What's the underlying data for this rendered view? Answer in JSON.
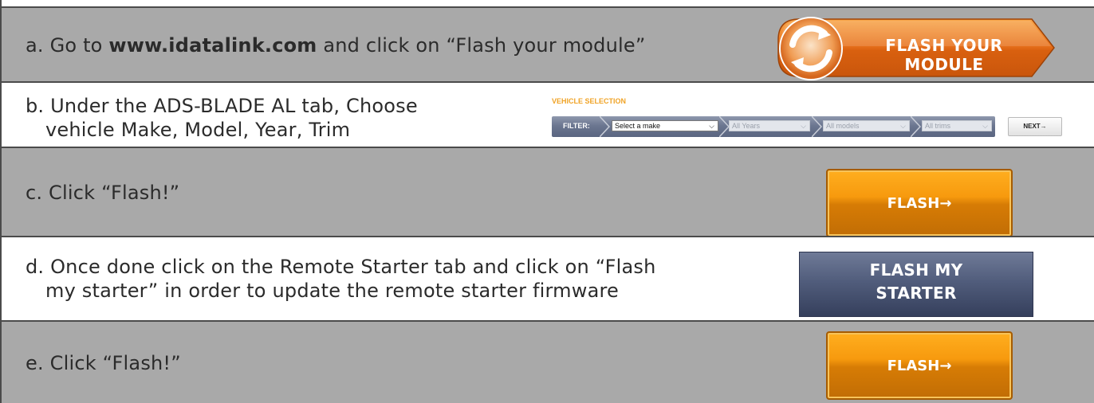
{
  "steps": {
    "a": {
      "prefix": "a. Go to ",
      "link": "www.idatalink.com",
      "suffix": " and click on “Flash your module”",
      "button_label": "FLASH YOUR MODULE",
      "icon": "refresh-icon"
    },
    "b": {
      "line1": "b. Under the ADS-BLADE AL tab, Choose",
      "line2": "vehicle Make, Model, Year, Trim",
      "widget": {
        "title": "VEHICLE SELECTION",
        "filter_label": "FILTER:",
        "make": "Select a make",
        "years": "All Years",
        "models": "All models",
        "trims": "All trims",
        "next": "NEXT→"
      }
    },
    "c": {
      "text": "c. Click “Flash!”",
      "button_label": "FLASH→"
    },
    "d": {
      "line1": "d. Once done click on the Remote Starter tab and click on “Flash",
      "line2": "my starter” in order to update the remote starter firmware",
      "button_line1": "FLASH MY",
      "button_line2": "STARTER"
    },
    "e": {
      "text": "e. Click “Flash!”",
      "button_label": "FLASH→"
    }
  },
  "colors": {
    "row_gray": "#a9a9a9",
    "border": "#4b4b4b",
    "orange": "#f79a0e",
    "navy": "#515d7c",
    "accent_title": "#f0a326"
  }
}
